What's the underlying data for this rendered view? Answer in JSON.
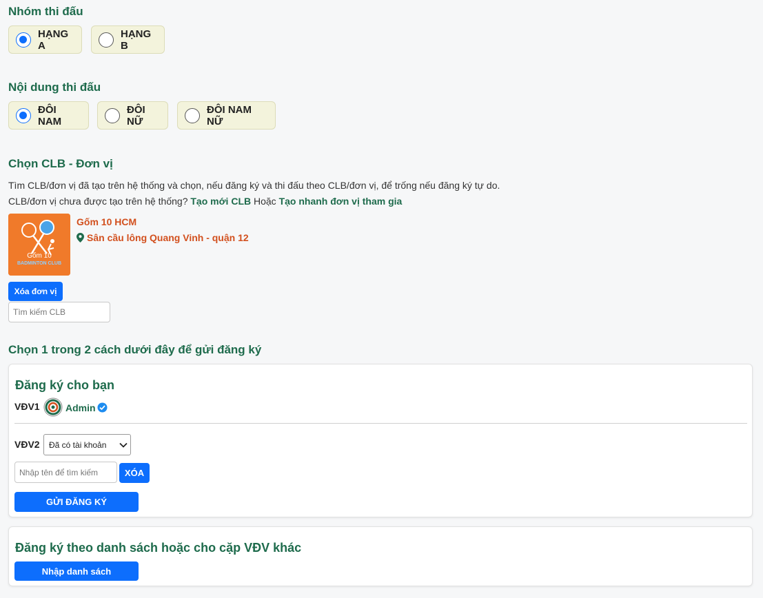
{
  "group": {
    "title": "Nhóm thi đấu",
    "options": [
      {
        "label": "HẠNG A",
        "checked": true
      },
      {
        "label": "HẠNG B",
        "checked": false
      }
    ]
  },
  "content": {
    "title": "Nội dung thi đấu",
    "options": [
      {
        "label": "ĐÔI NAM",
        "checked": true
      },
      {
        "label": "ĐÔI NỮ",
        "checked": false
      },
      {
        "label": "ĐÔI NAM NỮ",
        "checked": false
      }
    ]
  },
  "club": {
    "title": "Chọn CLB - Đơn vị",
    "help_text": "Tìm CLB/đơn vị đã tạo trên hệ thống và chọn, nếu đăng ký và thi đấu theo CLB/đơn vị, để trống nếu đăng ký tự do.",
    "not_created_text": "CLB/đơn vị chưa được tạo trên hệ thống?",
    "create_link": "Tạo mới CLB",
    "or_text": "Hoặc",
    "quick_create_link": "Tạo nhanh đơn vị tham gia",
    "selected": {
      "name": "Gốm 10 HCM",
      "venue": "Sân cầu lông Quang Vinh - quận 12",
      "logo_text_line1": "Gốm 10",
      "logo_text_line2": "BADMINTON CLUB"
    },
    "remove_button": "Xóa đơn vị",
    "search_placeholder": "Tìm kiếm CLB"
  },
  "register": {
    "title": "Chọn 1 trong 2 cách dưới đây để gửi đăng ký",
    "self_card": {
      "title": "Đăng ký cho bạn",
      "vdv1_label": "VĐV1",
      "vdv1_name": "Admin",
      "vdv2_label": "VĐV2",
      "vdv2_select": "Đã có tài khoản",
      "name_placeholder": "Nhập tên để tìm kiếm",
      "clear_button": "XÓA",
      "submit_button": "GỬI ĐĂNG KÝ"
    },
    "list_card": {
      "title": "Đăng ký theo danh sách hoặc cho cặp VĐV khác",
      "import_button": "Nhập danh sách"
    }
  },
  "colors": {
    "accent_green": "#1e6b4c",
    "primary_blue": "#0d6efd",
    "club_orange": "#d2501e",
    "radio_bg": "#f3f3dc"
  }
}
